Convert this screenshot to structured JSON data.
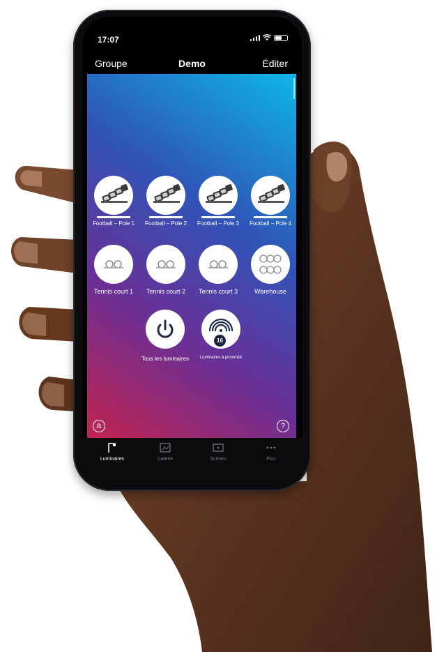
{
  "status": {
    "time": "17:07"
  },
  "nav": {
    "left": "Groupe",
    "title": "Demo",
    "right": "Éditer"
  },
  "groups": [
    {
      "label": "Football – Pole 1",
      "icon": "floodlight-pole-icon"
    },
    {
      "label": "Football – Pole 2",
      "icon": "floodlight-pole-icon"
    },
    {
      "label": "Football – Pole 3",
      "icon": "floodlight-pole-icon"
    },
    {
      "label": "Football – Pole 4",
      "icon": "floodlight-pole-icon"
    },
    {
      "label": "Tennis court 1",
      "icon": "double-luminaire-icon"
    },
    {
      "label": "Tennis court 2",
      "icon": "double-luminaire-icon"
    },
    {
      "label": "Tennis court 3",
      "icon": "double-luminaire-icon"
    },
    {
      "label": "Warehouse",
      "icon": "luminaire-grid-icon"
    }
  ],
  "actions": {
    "all": {
      "label": "Tous les luminaires",
      "icon": "power-icon"
    },
    "nearby": {
      "label": "Luminaires à proximité",
      "icon": "proximity-icon",
      "count": "16"
    }
  },
  "footer": {
    "a_icon": "a",
    "help_icon": "?"
  },
  "tabs": [
    {
      "label": "Luminaires",
      "icon": "luminaire-icon",
      "active": true
    },
    {
      "label": "Galerie",
      "icon": "gallery-icon",
      "active": false
    },
    {
      "label": "Scènes",
      "icon": "scenes-icon",
      "active": false
    },
    {
      "label": "Plus",
      "icon": "more-icon",
      "active": false
    }
  ],
  "colors": {
    "gradient_top": "#0db6e8",
    "gradient_mid": "#2f54b8",
    "gradient_bottom": "#c2244f",
    "tab_active": "#ffffff",
    "tab_inactive": "#7a7a80"
  }
}
